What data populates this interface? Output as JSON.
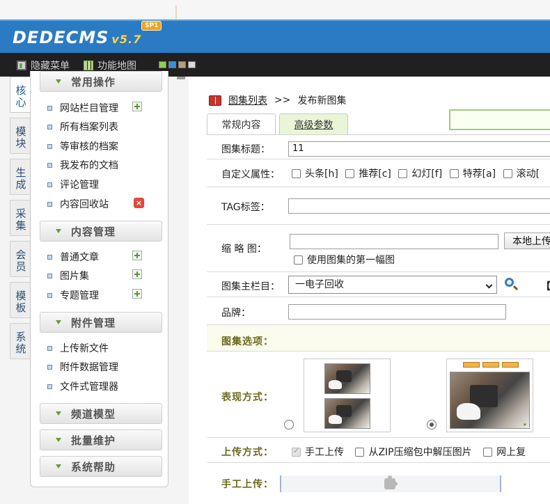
{
  "app": {
    "logo_text": "DEDECMS",
    "version": "v5.7",
    "badge": "SP1"
  },
  "menubar": {
    "hide_menu": "隐藏菜单",
    "site_map": "功能地图",
    "skin_colors": [
      "#8fd14f",
      "#3a8fd9",
      "#b5a07a",
      "#d9d9d9"
    ]
  },
  "side_tabs": [
    "核心",
    "模块",
    "生成",
    "采集",
    "会员",
    "模板",
    "系统"
  ],
  "left_menu": {
    "groups": {
      "common": "常用操作",
      "content": "内容管理",
      "attach": "附件管理",
      "channel": "频道模型",
      "batch": "批量维护",
      "help": "系统帮助"
    },
    "common_items": [
      "网站栏目管理",
      "所有档案列表",
      "等审核的档案",
      "我发布的文档",
      "评论管理",
      "内容回收站"
    ],
    "content_items": [
      "普通文章",
      "图片集",
      "专题管理"
    ],
    "attach_items": [
      "上传新文件",
      "附件数据管理",
      "文件式管理器"
    ]
  },
  "breadcrumb": {
    "link": "图集列表",
    "sep": ">>",
    "current": "发布新图集"
  },
  "tabs": {
    "normal": "常规内容",
    "advanced": "高级参数"
  },
  "form": {
    "title_label": "图集标题：",
    "title_value": "11",
    "flags_label": "自定义属性：",
    "flags": [
      "头条[h]",
      "推荐[c]",
      "幻灯[f]",
      "特荐[a]",
      "滚动["
    ],
    "tag_label": "TAG标签：",
    "tag_value": "",
    "thumb_label": "缩 略 图：",
    "thumb_value": "",
    "upload_local": "本地上传",
    "use_first_image": "使用图集的第一幅图",
    "main_column_label": "图集主栏目：",
    "main_column_value": "一电子回收",
    "bracket": "【",
    "brand_label": "品牌：",
    "brand_value": "",
    "section_title": "图集选项：",
    "display_label": "表现方式：",
    "upload_label": "上传方式：",
    "upload_options": [
      "手工上传",
      "从ZIP压缩包中解压图片",
      "网上复"
    ],
    "manual_label": "手工上传："
  }
}
